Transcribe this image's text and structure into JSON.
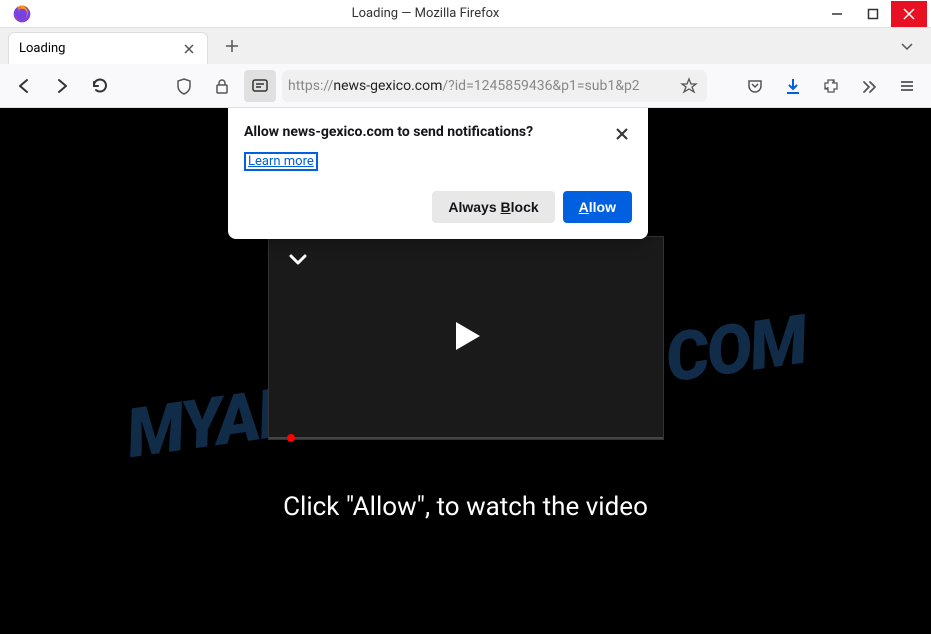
{
  "titlebar": {
    "title": "Loading — Mozilla Firefox"
  },
  "tab": {
    "title": "Loading"
  },
  "url": {
    "protocol": "https://",
    "domain": "news-gexico.com",
    "path": "/?id=1245859436&p1=sub1&p2"
  },
  "popup": {
    "title": "Allow news-gexico.com to send notifications?",
    "learn_more": "Learn more",
    "block_prefix": "Always ",
    "block_key": "B",
    "block_suffix": "lock",
    "allow_key": "A",
    "allow_suffix": "llow"
  },
  "content": {
    "instruction": "Click \"Allow\", to watch the video",
    "watermark": "MYANTISPYWARE.COM"
  }
}
